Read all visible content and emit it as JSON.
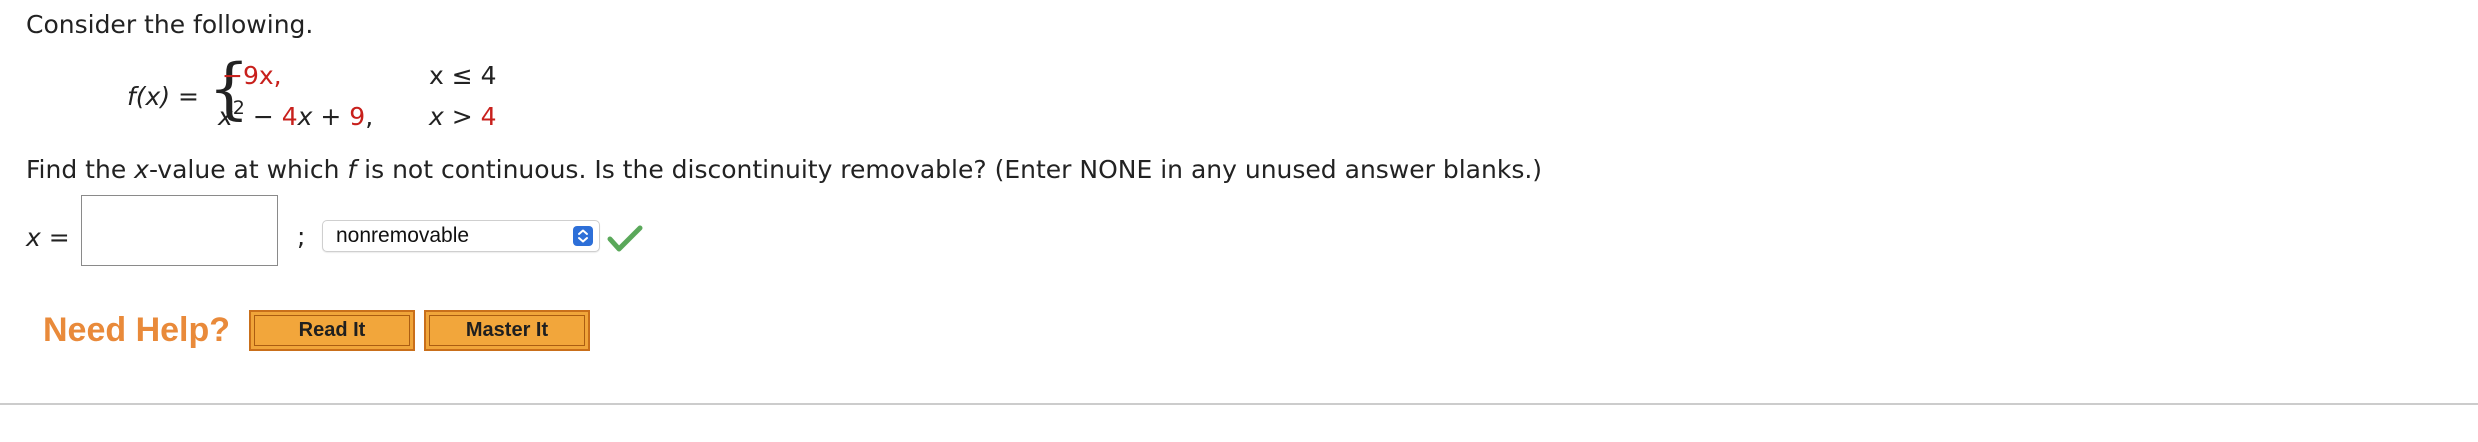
{
  "prompt": "Consider the following.",
  "function": {
    "lhs": "f(x) =",
    "piece1": {
      "expr": "−9x,",
      "cond": "x ≤ 4"
    },
    "piece2": {
      "x": "x",
      "exp": "2",
      "minus": " − ",
      "coef": "4",
      "mid": "x + ",
      "const": "9",
      "comma": ",",
      "cond_var": "x > ",
      "cond_val": "4"
    }
  },
  "question": {
    "pre": "Find the ",
    "x": "x",
    "mid1": "-value at which ",
    "f": "f",
    "post": " is not continuous. Is the discontinuity removable? (Enter NONE in any unused answer blanks.)"
  },
  "answer": {
    "label_var": "x",
    "label_eq": " =",
    "value": "",
    "separator": ";",
    "select_value": "nonremovable"
  },
  "help": {
    "title": "Need Help?",
    "read_it": "Read It",
    "master_it": "Master It"
  },
  "colors": {
    "accent_red": "#c8201c",
    "help_orange": "#e98a3a",
    "button_orange": "#f0a53a",
    "check_green": "#5aa85a",
    "select_blue": "#2d6fd8"
  },
  "icons": {
    "status": "checkmark-icon",
    "select": "chevron-updown-icon"
  }
}
